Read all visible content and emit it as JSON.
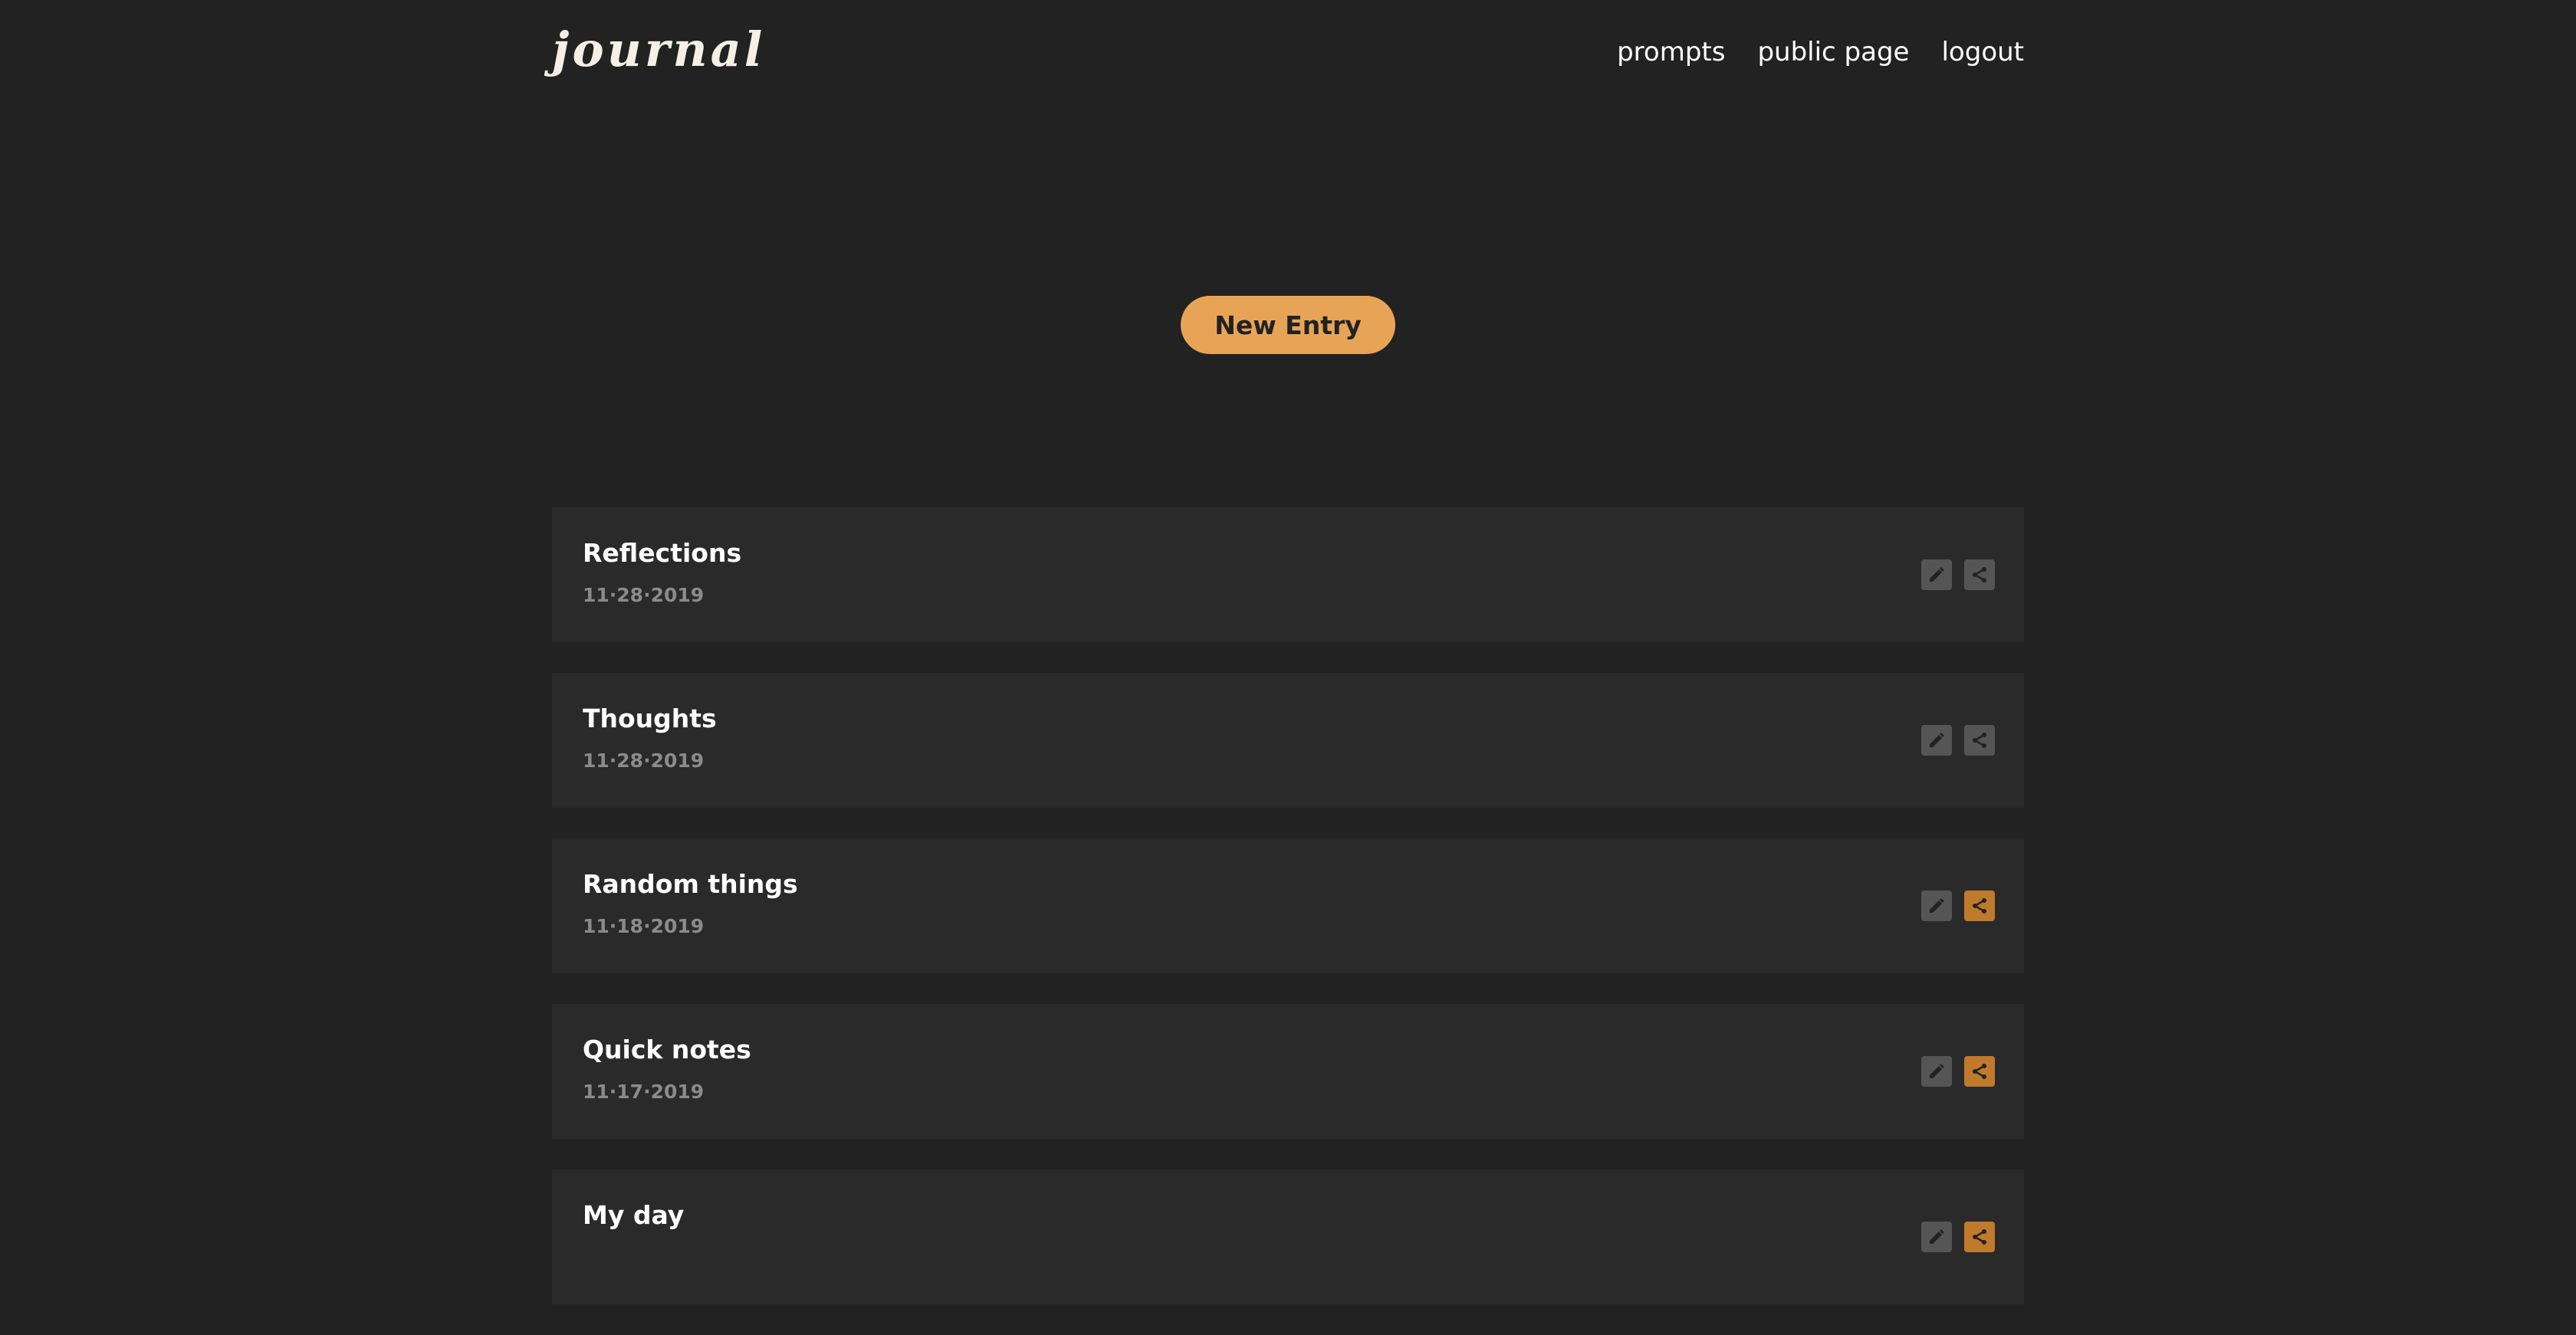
{
  "header": {
    "logo_text": "journal",
    "nav": [
      {
        "label": "prompts"
      },
      {
        "label": "public page"
      },
      {
        "label": "logout"
      }
    ]
  },
  "actions": {
    "new_entry_label": "New Entry"
  },
  "entries": [
    {
      "title": "Reflections",
      "date": "11·28·2019",
      "shared": false
    },
    {
      "title": "Thoughts",
      "date": "11·28·2019",
      "shared": false
    },
    {
      "title": "Random things",
      "date": "11·18·2019",
      "shared": true
    },
    {
      "title": "Quick notes",
      "date": "11·17·2019",
      "shared": true
    },
    {
      "title": "My day",
      "date": "",
      "shared": true
    }
  ],
  "colors": {
    "background": "#222222",
    "card": "#2a2a2a",
    "accent": "#e8a456",
    "shared_icon": "#c07a2c",
    "icon_bg": "#555555",
    "date_text": "#8b8b8b"
  },
  "icons": {
    "edit": "pencil-icon",
    "share": "share-icon"
  }
}
